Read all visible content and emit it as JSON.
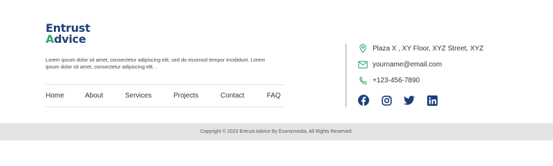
{
  "brand": {
    "line1": "Entrust",
    "line2_prefix": "A",
    "line2_rest": "dvice",
    "primary_color": "#1d3f7a",
    "accent_color": "#2fa76a"
  },
  "description": "Lorem ipsum dolor sit amet, consectetur adipiscing elit, sed do eiusmod tempor incididunt. Lorem ipsum dolor sit amet, consectetur adipiscing elit. .",
  "nav": {
    "items": [
      {
        "label": "Home"
      },
      {
        "label": "About"
      },
      {
        "label": "Services"
      },
      {
        "label": "Projects"
      },
      {
        "label": "Contact"
      },
      {
        "label": "FAQ"
      }
    ]
  },
  "contact": {
    "address": "Plaza X , XY Floor, XYZ Street, XYZ",
    "email": "yourname@email.com",
    "phone": "+123-456-7890",
    "icon_color": "#2fa76a",
    "icons": [
      "map-pin-icon",
      "envelope-icon",
      "phone-icon"
    ]
  },
  "social": {
    "color": "#1d3f7a",
    "icons": [
      "facebook-icon",
      "instagram-icon",
      "twitter-icon",
      "linkedin-icon"
    ]
  },
  "copyright": "Copyright © 2023 Entrust Advice By Evonicmedia. All Rights Reserved."
}
